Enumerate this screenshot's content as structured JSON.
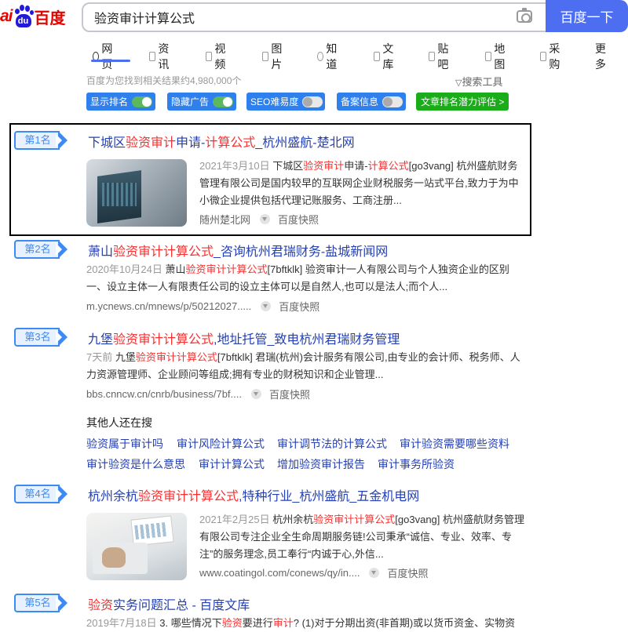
{
  "logo": {
    "text_left": "ai",
    "text_paw": "du",
    "text_right": "百度"
  },
  "search": {
    "query": "验资审计计算公式",
    "button_label": "百度一下"
  },
  "tabs": [
    {
      "label": "网页",
      "active": true
    },
    {
      "label": "资讯"
    },
    {
      "label": "视频"
    },
    {
      "label": "图片"
    },
    {
      "label": "知道"
    },
    {
      "label": "文库"
    },
    {
      "label": "贴吧"
    },
    {
      "label": "地图"
    },
    {
      "label": "采购"
    },
    {
      "label": "更多"
    }
  ],
  "result_count": "百度为您找到相关结果约4,980,000个",
  "search_tools_label": "搜索工具",
  "pills": [
    {
      "label": "显示排名",
      "state": "on"
    },
    {
      "label": "隐藏广告",
      "state": "on"
    },
    {
      "label": "SEO难易度",
      "state": "off"
    },
    {
      "label": "备案信息",
      "state": "off"
    },
    {
      "label": "文章排名潜力评估 >"
    }
  ],
  "results": [
    {
      "rank": "第1名",
      "title_parts": [
        "下城区",
        "验资审计",
        "申请-",
        "计算公式",
        "_杭州盛航-楚北网"
      ],
      "date": "2021年3月10日",
      "desc_parts": [
        "下城区",
        "验资审计",
        "申请-",
        "计算公式",
        "[go3vang] 杭州盛航财务管理有限公司是国内较早的互联网企业财税服务一站式平台,致力于为中小微企业提供包括代理记账服务、工商注册..."
      ],
      "source": "随州楚北网",
      "snapshot": "百度快照"
    },
    {
      "rank": "第2名",
      "title_parts": [
        "萧山",
        "验资审计计算公式",
        "_咨询杭州君瑞财务-盐城新闻网"
      ],
      "date": "2020年10月24日",
      "desc_parts": [
        "萧山",
        "验资审计计算公式",
        "[7bftklk] 验资审计一人有限公司与个人独资企业的区别一、设立主体一人有限责任公司的设立主体可以是自然人,也可以是法人;而个人..."
      ],
      "source": "m.ycnews.cn/mnews/p/50212027.....",
      "snapshot": "百度快照"
    },
    {
      "rank": "第3名",
      "title_parts": [
        "九堡",
        "验资审计计算公式",
        ",地址托管_致电杭州君瑞财务管理"
      ],
      "date": "7天前",
      "desc_parts": [
        "九堡",
        "验资审计计算公式",
        "[7bftklk] 君瑞(杭州)会计服务有限公司,由专业的会计师、税务师、人力资源管理师、企业顾问等组成;拥有专业的财税知识和企业管理..."
      ],
      "source": "bbs.cnncw.cn/cnrb/business/7bf....",
      "snapshot": "百度快照"
    },
    {
      "rank": "第4名",
      "title_parts": [
        "杭州余杭",
        "验资审计计算公式",
        ",特种行业_杭州盛航_五金机电网"
      ],
      "date": "2021年2月25日",
      "desc_parts": [
        "杭州余杭",
        "验资审计计算公式",
        "[go3vang] 杭州盛航财务管理有限公司专注企业全生命周期服务链!公司秉承“诚信、专业、效率、专注”的服务理念,员工奉行“内诚于心,外信..."
      ],
      "source": "www.coatingol.com/conews/qy/in....",
      "snapshot": "百度快照"
    },
    {
      "rank": "第5名",
      "title_parts": [
        "",
        "验资",
        "实务问题汇总 - 百度文库"
      ],
      "date": "2019年7月18日",
      "desc_parts": [
        "3. 哪些情况下",
        "验资",
        "要进行",
        "审计",
        "? (1)对于分期出资(非首期)或以货币资金、实物资"
      ]
    }
  ],
  "related": {
    "title": "其他人还在搜",
    "links": [
      "验资属于审计吗",
      "审计风险计算公式",
      "审计调节法的计算公式",
      "审计验资需要哪些资料",
      "审计验资是什么意思",
      "审计计算公式",
      "增加验资审计报告",
      "审计事务所验资"
    ]
  },
  "colors": {
    "link": "#2440b3",
    "highlight": "#f73131",
    "accent": "#4e6ef2",
    "pill": "#2f80ed",
    "rank": "#3d8bf2"
  }
}
